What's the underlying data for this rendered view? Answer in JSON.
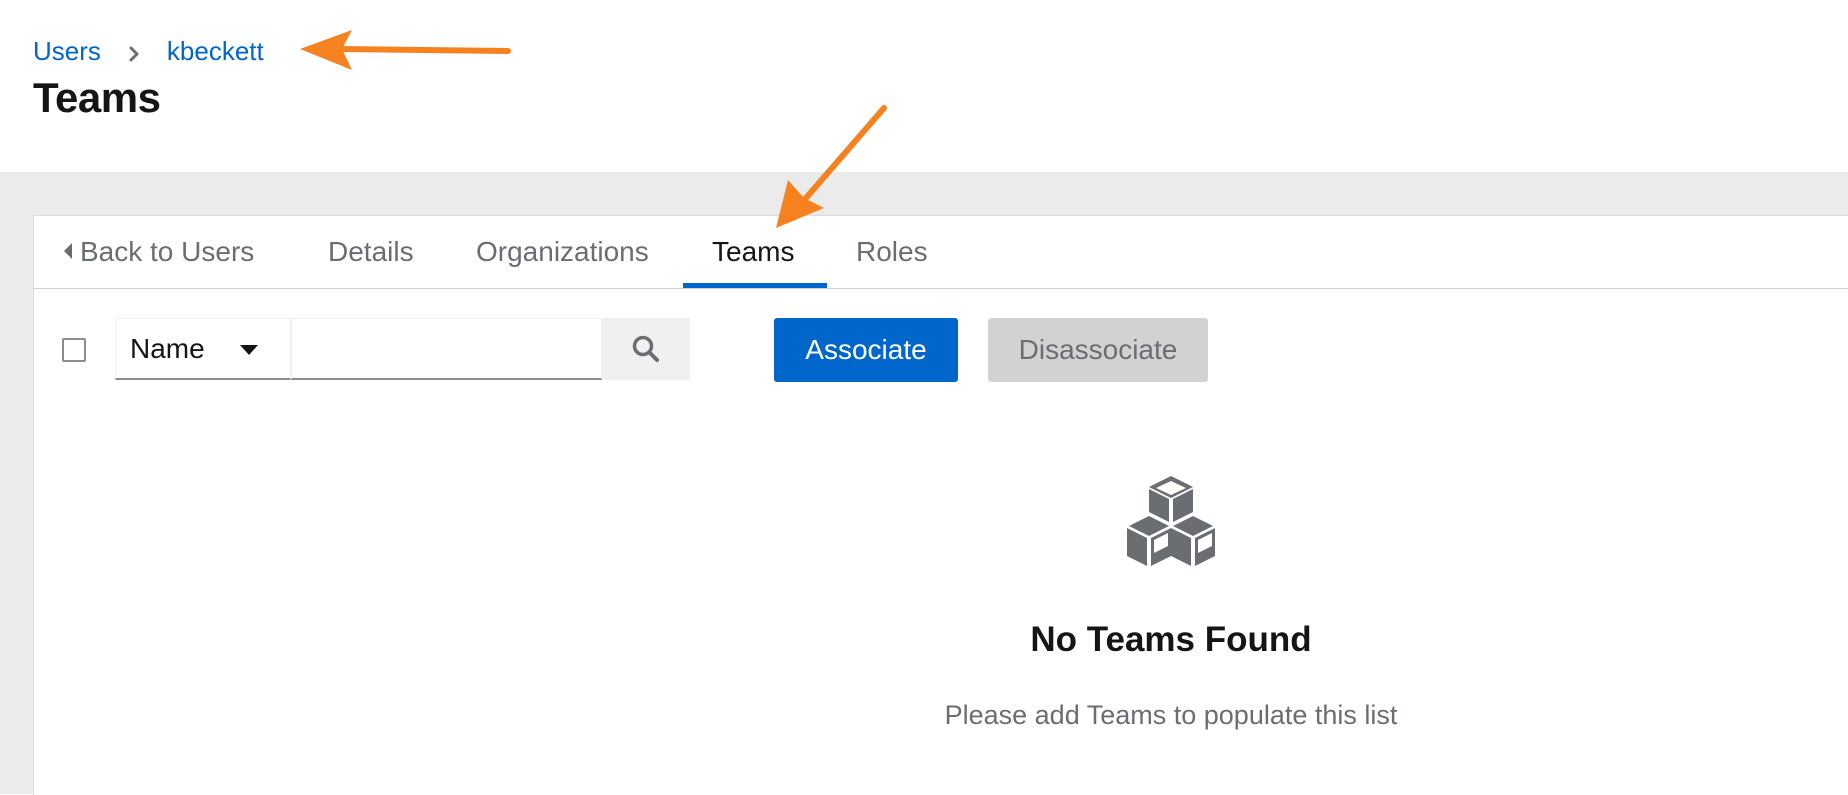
{
  "breadcrumb": {
    "items": [
      {
        "label": "Users"
      },
      {
        "label": "kbeckett"
      }
    ]
  },
  "page": {
    "title": "Teams"
  },
  "tabs": {
    "back_label": "Back to Users",
    "items": [
      {
        "label": "Details"
      },
      {
        "label": "Organizations"
      },
      {
        "label": "Teams",
        "active": true
      },
      {
        "label": "Roles"
      }
    ]
  },
  "toolbar": {
    "filter_field": "Name",
    "search_value": "",
    "associate_label": "Associate",
    "disassociate_label": "Disassociate"
  },
  "empty_state": {
    "icon": "cubes-icon",
    "title": "No Teams Found",
    "body": "Please add Teams to populate this list"
  },
  "colors": {
    "link": "#0066cc",
    "primary_button": "#0066cc",
    "disabled_button": "#d2d2d2",
    "annotation_arrow": "#f5821f",
    "background_band": "#ebebeb"
  }
}
